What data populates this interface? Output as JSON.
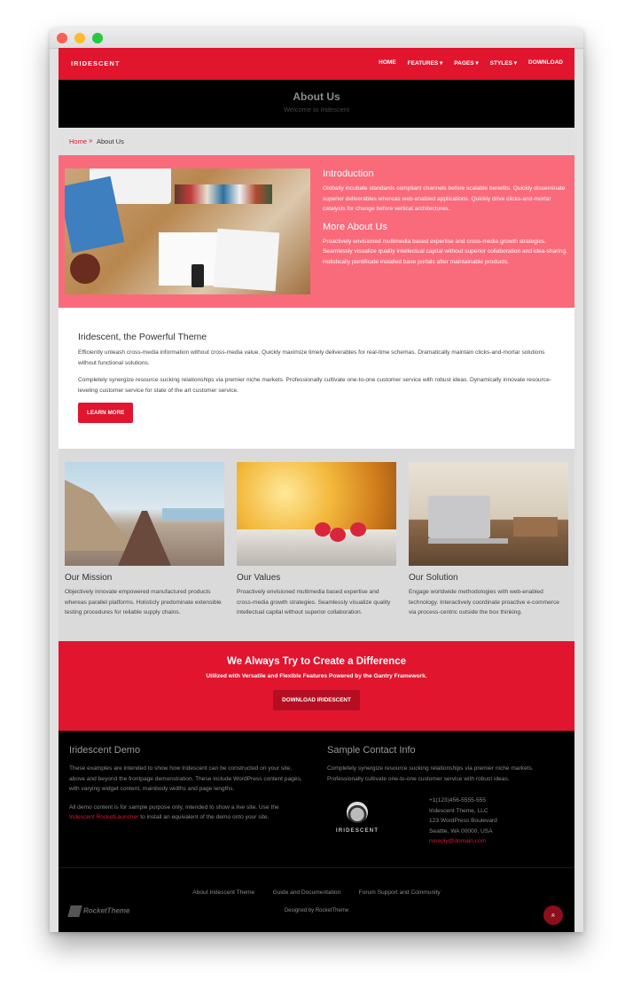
{
  "nav": {
    "logo": "IRIDESCENT",
    "items": [
      {
        "label": "HOME"
      },
      {
        "label": "FEATURES ▾"
      },
      {
        "label": "PAGES ▾"
      },
      {
        "label": "STYLES ▾"
      },
      {
        "label": "DOWNLOAD"
      }
    ]
  },
  "header": {
    "title": "About Us",
    "subtitle": "Welcome to Iridescent"
  },
  "breadcrumb": {
    "home": "Home",
    "separator": "»",
    "current": "About Us"
  },
  "intro": {
    "h1": "Introduction",
    "p1": "Globally incubate standards compliant channels before scalable benefits. Quickly disseminate superior deliverables whereas web-enabled applications. Quickly drive clicks-and-mortar catalysts for change before vertical architectures.",
    "h2": "More About Us",
    "p2": "Proactively envisioned multimedia based expertise and cross-media growth strategies. Seamlessly visualize quality intellectual capital without superior collaboration and idea-sharing. Holistically pontificate installed base portals after maintainable products."
  },
  "theme": {
    "title": "Iridescent, the Powerful Theme",
    "p1": "Efficiently unleash cross-media information without cross-media value. Quickly maximize timely deliverables for real-time schemas. Dramatically maintain clicks-and-mortar solutions without functional solutions.",
    "p2": "Completely synergize resource sucking relationships via premier niche markets. Professionally cultivate one-to-one customer service with robust ideas. Dynamically innovate resource-leveling customer service for state of the art customer service.",
    "button": "LEARN MORE"
  },
  "features": [
    {
      "title": "Our Mission",
      "text": "Objectively innovate empowered manufactured products whereas parallel platforms. Holisticly predominate extensible testing procedures for reliable supply chains."
    },
    {
      "title": "Our Values",
      "text": "Proactively envisioned multimedia based expertise and cross-media growth strategies. Seamlessly visualize quality intellectual capital without superior collaboration."
    },
    {
      "title": "Our Solution",
      "text": "Engage worldwide methodologies with web-enabled technology. Interactively coordinate proactive e-commerce via process-centric outside the box thinking."
    }
  ],
  "cta": {
    "title": "We Always Try to Create a Difference",
    "text": "Utilized with Versatile and Flexible Features Powered by the Gantry Framework.",
    "button": "DOWNLOAD IRIDESCENT"
  },
  "footer": {
    "demo": {
      "title": "Iridescent Demo",
      "p1": "These examples are intended to show how Iridescent can be constructed on your site, above and beyond the frontpage demonstration. These include WordPress content pages, with varying widget content, mainbody widths and page lengths.",
      "p2_before": "All demo content is for sample purpose only, intended to show a live site. Use the ",
      "p2_link": "Iridescent RocketLauncher",
      "p2_after": " to install an equivalent of the demo onto your site."
    },
    "contact": {
      "title": "Sample Contact Info",
      "text": "Completely synergize resource sucking relationships via premier niche markets. Professionally cultivate one-to-one customer service with robust ideas.",
      "brand": "IRIDESCENT",
      "phone": "+1(123)456-5555-555",
      "company": "Iridescent Theme, LLC",
      "street": "123 WordPress Boulevard",
      "city": "Seattle, WA 00000, USA",
      "email": "noreply@domain.com"
    },
    "links": [
      "About Iridescent Theme",
      "Guide and Documentation",
      "Forum Support and Community"
    ],
    "designed": "Designed by RocketTheme",
    "rocket_logo": "RocketTheme",
    "to_top": "»"
  },
  "colors": {
    "accent": "#e1152d",
    "intro_bg": "#f96b7b",
    "dark": "#000000"
  }
}
